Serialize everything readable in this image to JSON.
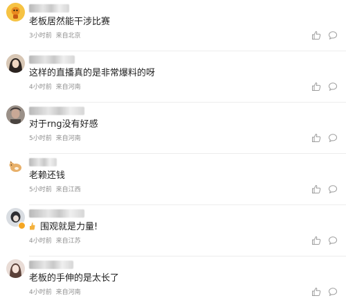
{
  "comments": [
    {
      "text": "老板居然能干涉比赛",
      "time": "3小时前",
      "location": "来自北京",
      "avatar": "avatar-orange-cartoon",
      "emoji_prefix": ""
    },
    {
      "text": "这样的直播真的是非常爆料的呀",
      "time": "4小时前",
      "location": "来自河南",
      "avatar": "avatar-girl-photo",
      "emoji_prefix": ""
    },
    {
      "text": "对于rng没有好感",
      "time": "5小时前",
      "location": "来自河南",
      "avatar": "avatar-person-photo",
      "emoji_prefix": ""
    },
    {
      "text": "老赖还钱",
      "time": "5小时前",
      "location": "来自江西",
      "avatar": "avatar-dog-cartoon",
      "emoji_prefix": ""
    },
    {
      "text": "围观就是力量!",
      "time": "4小时前",
      "location": "来自江苏",
      "avatar": "avatar-dark-photo",
      "emoji_prefix": "thumbs-up-emoji"
    },
    {
      "text": "老板的手伸的是太长了",
      "time": "4小时前",
      "location": "来自河南",
      "avatar": "avatar-girl-photo-2",
      "emoji_prefix": ""
    }
  ],
  "icons": {
    "like": "like-icon",
    "reply": "reply-icon"
  },
  "colors": {
    "text": "#1f1f1f",
    "meta": "#8e8e8e",
    "icon": "#9a9a9a",
    "divider": "#ececec"
  }
}
